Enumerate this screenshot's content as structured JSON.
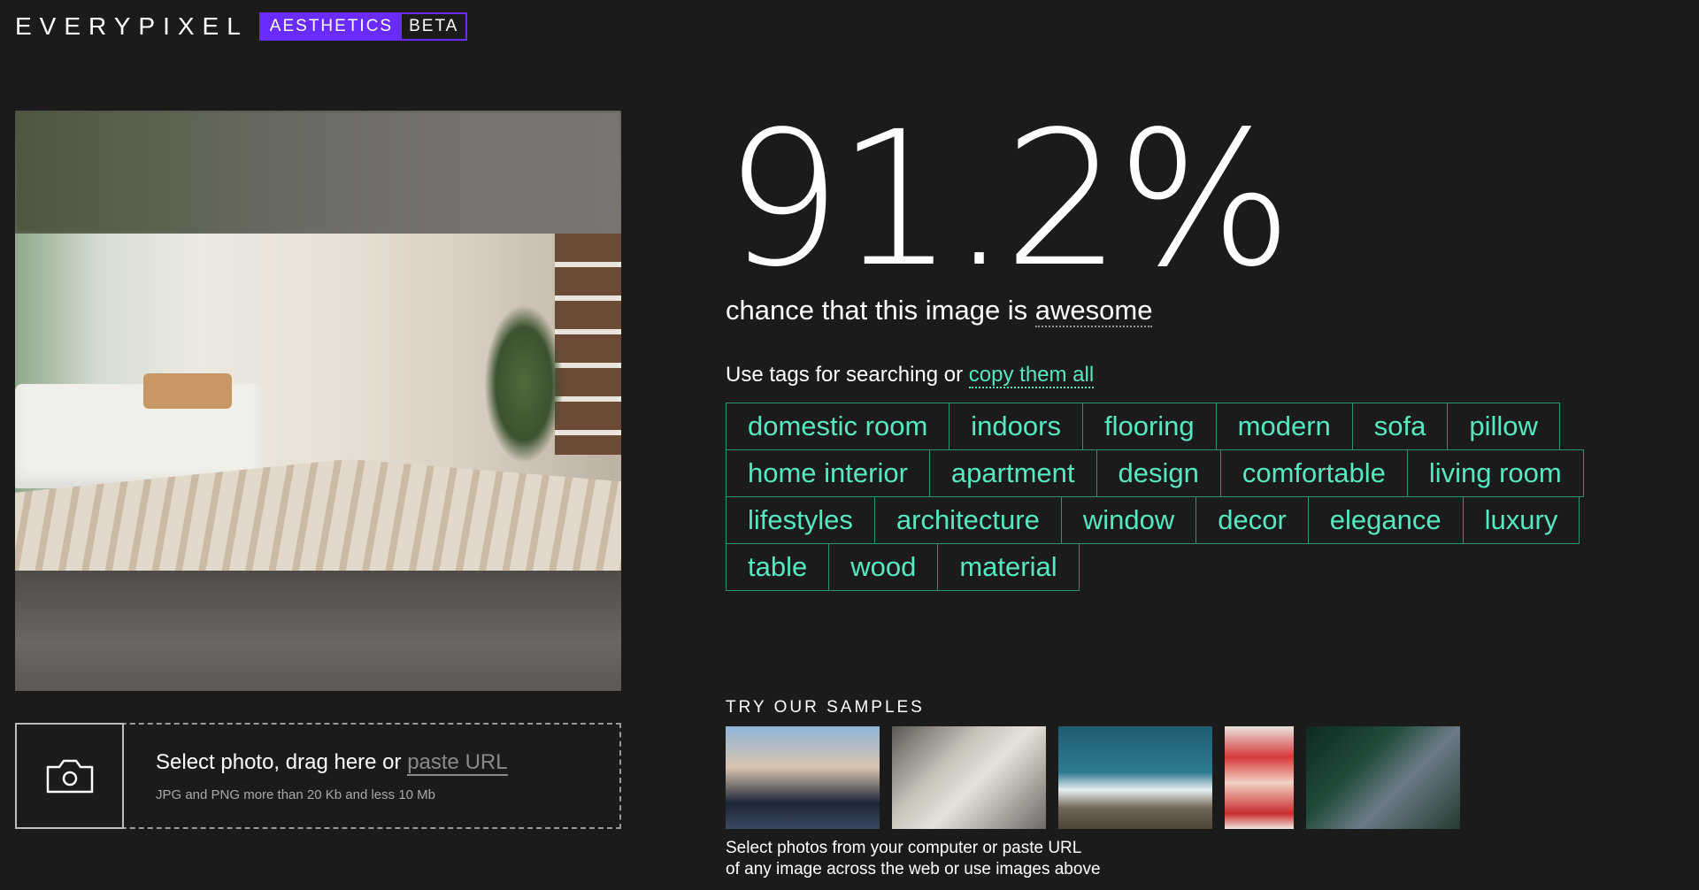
{
  "logo": {
    "word": "EVERYPIXEL",
    "badge_primary": "AESTHETICS",
    "badge_secondary": "BETA"
  },
  "upload": {
    "prompt": "Select photo, drag here or ",
    "link": "paste URL",
    "hint": "JPG and PNG more than 20 Kb and less 10 Mb",
    "icon": "camera-icon"
  },
  "result": {
    "score": "91.2%",
    "subtitle_prefix": "chance that this image is ",
    "subtitle_word": "awesome"
  },
  "tags_hint": {
    "prefix": "Use tags for searching or ",
    "link": "copy them all"
  },
  "tags": [
    [
      "domestic room",
      "indoors",
      "flooring",
      "modern",
      "sofa",
      "pillow"
    ],
    [
      "home interior",
      "apartment",
      "design",
      "comfortable",
      "living room"
    ],
    [
      "lifestyles",
      "architecture",
      "window",
      "decor",
      "elegance",
      "luxury"
    ],
    [
      "table",
      "wood",
      "material"
    ]
  ],
  "samples": {
    "title": "TRY OUR SAMPLES",
    "note_line1": "Select photos from your computer or paste URL",
    "note_line2": "of any image across the web or use images above"
  },
  "colors": {
    "accent_tag": "#56e8be",
    "badge": "#6a2bff",
    "background": "#1b1b1b"
  }
}
